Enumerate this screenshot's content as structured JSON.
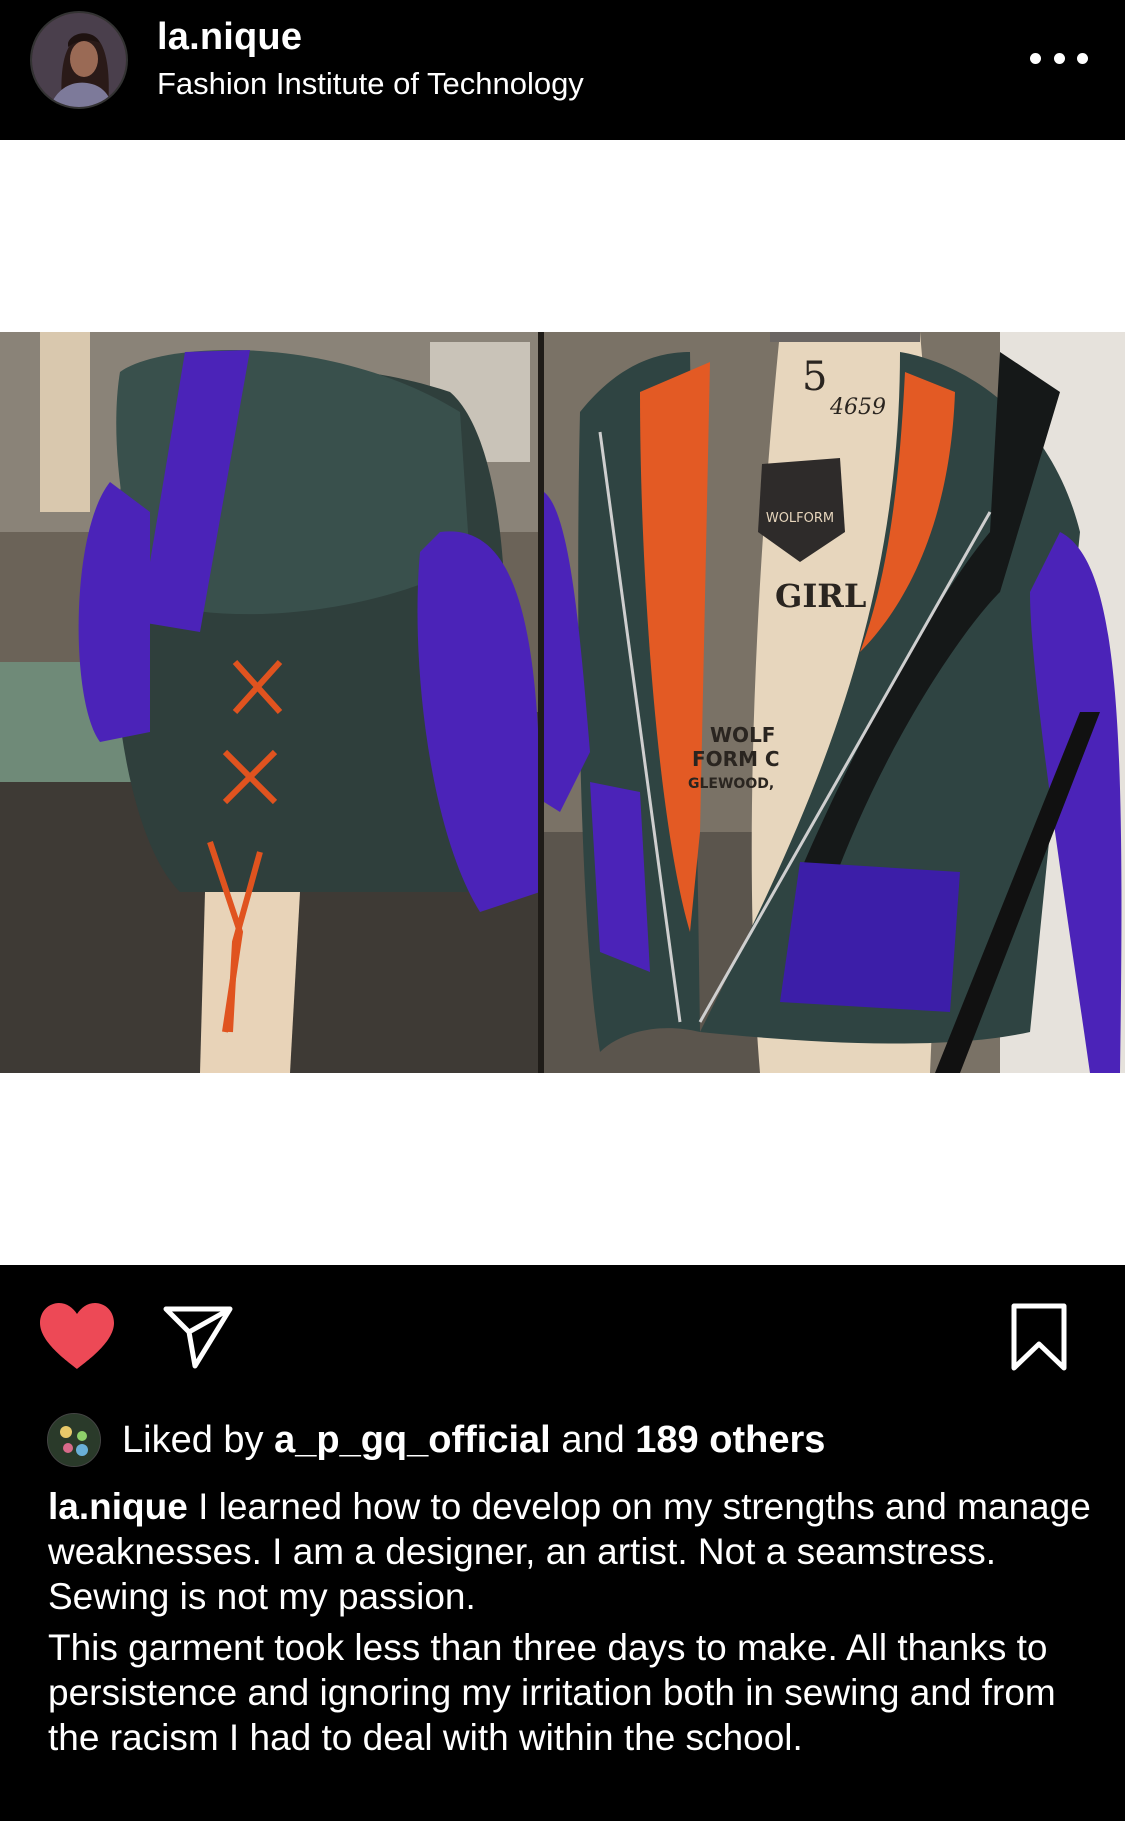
{
  "post": {
    "username": "la.nique",
    "location": "Fashion Institute of Technology"
  },
  "photo": {
    "mannequin_marks": {
      "size": "5",
      "serial": "4659",
      "badge": "WOLFORM",
      "label": "GIRL",
      "maker_line1": "WOLF",
      "maker_line2": "FORM C",
      "maker_line3": "GLEWOOD,"
    }
  },
  "icons": {
    "like": "heart-icon",
    "share": "paper-plane-icon",
    "save": "bookmark-icon",
    "more": "more-options-icon"
  },
  "colors": {
    "background": "#000000",
    "like_red": "#ed4956",
    "text": "#ffffff"
  },
  "likes": {
    "prefix": "Liked by",
    "first_user": "a_p_gq_official",
    "connector": "and",
    "others": "189 others"
  },
  "caption": {
    "author": "la.nique",
    "paragraph1": "I learned how to develop on my strengths and manage weaknesses. I am a designer, an artist. Not a seamstress. Sewing is not my passion.",
    "paragraph2": "This garment took less than three days to make. All thanks to persistence and ignoring my irritation both in sewing and from the racism I had to deal with within the school."
  }
}
